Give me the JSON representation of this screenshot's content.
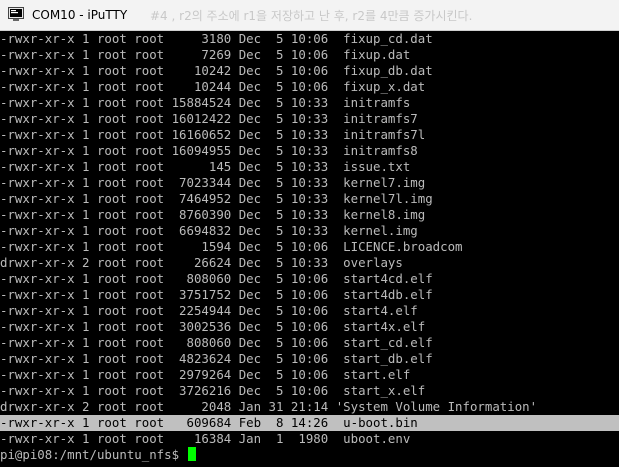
{
  "window": {
    "title": "COM10 - iPuTTY",
    "background_title_fragment": "#4 , r2의 주소에 r1을 저장하고 난 후, r2를 4만큼 증가시킨다."
  },
  "terminal": {
    "colors": {
      "foreground": "#bbbbbb",
      "background": "#000000",
      "selection_bg": "#c0c0c0",
      "cursor": "#00ff00"
    },
    "lines": [
      "-rwxr-xr-x 1 root root     3180 Dec  5 10:06  fixup_cd.dat",
      "-rwxr-xr-x 1 root root     7269 Dec  5 10:06  fixup.dat",
      "-rwxr-xr-x 1 root root    10242 Dec  5 10:06  fixup_db.dat",
      "-rwxr-xr-x 1 root root    10244 Dec  5 10:06  fixup_x.dat",
      "-rwxr-xr-x 1 root root 15884524 Dec  5 10:33  initramfs",
      "-rwxr-xr-x 1 root root 16012422 Dec  5 10:33  initramfs7",
      "-rwxr-xr-x 1 root root 16160652 Dec  5 10:33  initramfs7l",
      "-rwxr-xr-x 1 root root 16094955 Dec  5 10:33  initramfs8",
      "-rwxr-xr-x 1 root root      145 Dec  5 10:33  issue.txt",
      "-rwxr-xr-x 1 root root  7023344 Dec  5 10:33  kernel7.img",
      "-rwxr-xr-x 1 root root  7464952 Dec  5 10:33  kernel7l.img",
      "-rwxr-xr-x 1 root root  8760390 Dec  5 10:33  kernel8.img",
      "-rwxr-xr-x 1 root root  6694832 Dec  5 10:33  kernel.img",
      "-rwxr-xr-x 1 root root     1594 Dec  5 10:06  LICENCE.broadcom",
      "drwxr-xr-x 2 root root    26624 Dec  5 10:33  overlays",
      "-rwxr-xr-x 1 root root   808060 Dec  5 10:06  start4cd.elf",
      "-rwxr-xr-x 1 root root  3751752 Dec  5 10:06  start4db.elf",
      "-rwxr-xr-x 1 root root  2254944 Dec  5 10:06  start4.elf",
      "-rwxr-xr-x 1 root root  3002536 Dec  5 10:06  start4x.elf",
      "-rwxr-xr-x 1 root root   808060 Dec  5 10:06  start_cd.elf",
      "-rwxr-xr-x 1 root root  4823624 Dec  5 10:06  start_db.elf",
      "-rwxr-xr-x 1 root root  2979264 Dec  5 10:06  start.elf",
      "-rwxr-xr-x 1 root root  3726216 Dec  5 10:06  start_x.elf",
      "drwxr-xr-x 2 root root     2048 Jan 31 21:14 'System Volume Information'",
      "-rwxr-xr-x 1 root root   609684 Feb  8 14:26  u-boot.bin",
      "-rwxr-xr-x 1 root root    16384 Jan  1  1980  uboot.env"
    ],
    "selected_line_index": 24,
    "prompt": "pi@pi08:/mnt/ubuntu_nfs$ "
  }
}
